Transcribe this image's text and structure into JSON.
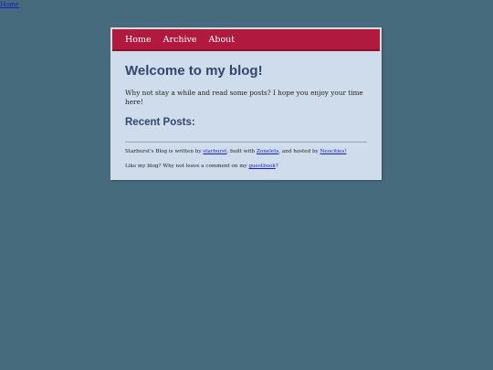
{
  "top_link": "Home",
  "nav": {
    "items": [
      "Home",
      "Archive",
      "About"
    ]
  },
  "main": {
    "title": "Welcome to my blog!",
    "intro": "Why not stay a while and read some posts? I hope you enjoy your time here!",
    "recent_heading": "Recent Posts:"
  },
  "footer": {
    "line1_prefix": "Starburst's Blog is written by ",
    "author_link": "starburst",
    "line1_mid": ", built with ",
    "builder_link": "Zonelets",
    "line1_mid2": ", and hosted by ",
    "host_link": "Neocities!",
    "line2_prefix": "Like my blog? Why not leave a comment on my ",
    "guestbook_link": "guestbook",
    "line2_suffix": "?"
  },
  "colors": {
    "background": "#456b7c",
    "nav_bar": "#b01a3e",
    "card": "#cfdceb",
    "heading": "#33466f",
    "link": "#1d1dcc"
  }
}
